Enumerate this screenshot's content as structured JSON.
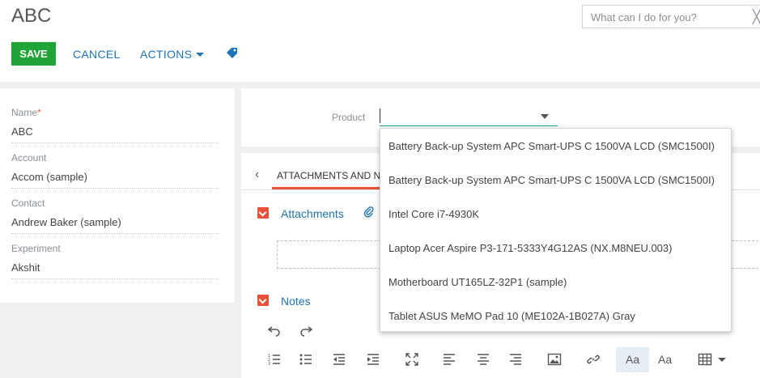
{
  "header": {
    "title": "ABC",
    "search_placeholder": "What can I do for you?"
  },
  "toolbar": {
    "save_label": "SAVE",
    "cancel_label": "CANCEL",
    "actions_label": "ACTIONS"
  },
  "profile": {
    "fields": [
      {
        "label": "Name",
        "required": "*",
        "value": "ABC"
      },
      {
        "label": "Account",
        "value": "Accom (sample)"
      },
      {
        "label": "Contact",
        "value": "Andrew Baker (sample)"
      },
      {
        "label": "Experiment",
        "value": "Akshit"
      }
    ]
  },
  "product": {
    "label": "Product",
    "value": "",
    "options": [
      "Battery Back-up System APC Smart-UPS C 1500VA LCD (SMC1500I)",
      "Battery Back-up System APC Smart-UPS C 1500VA LCD (SMC1500I)",
      "Intel Core i7-4930K",
      "Laptop Acer Aspire P3-171-5333Y4G12AS (NX.M8NEU.003)",
      "Motherboard UT165LZ-32P1 (sample)",
      "Tablet ASUS MeMO Pad 10 (ME102A-1B027A) Gray"
    ]
  },
  "tabs": {
    "active_label": "ATTACHMENTS AND NOTES"
  },
  "sections": {
    "attachments_title": "Attachments",
    "notes_title": "Notes"
  },
  "editor": {
    "font_label_active": "Aa",
    "font_label": "Aa"
  },
  "colors": {
    "save_green": "#21a437",
    "link_blue": "#1f74b8",
    "accent_orange": "#e8523a",
    "input_focus": "#1a9e7e"
  }
}
